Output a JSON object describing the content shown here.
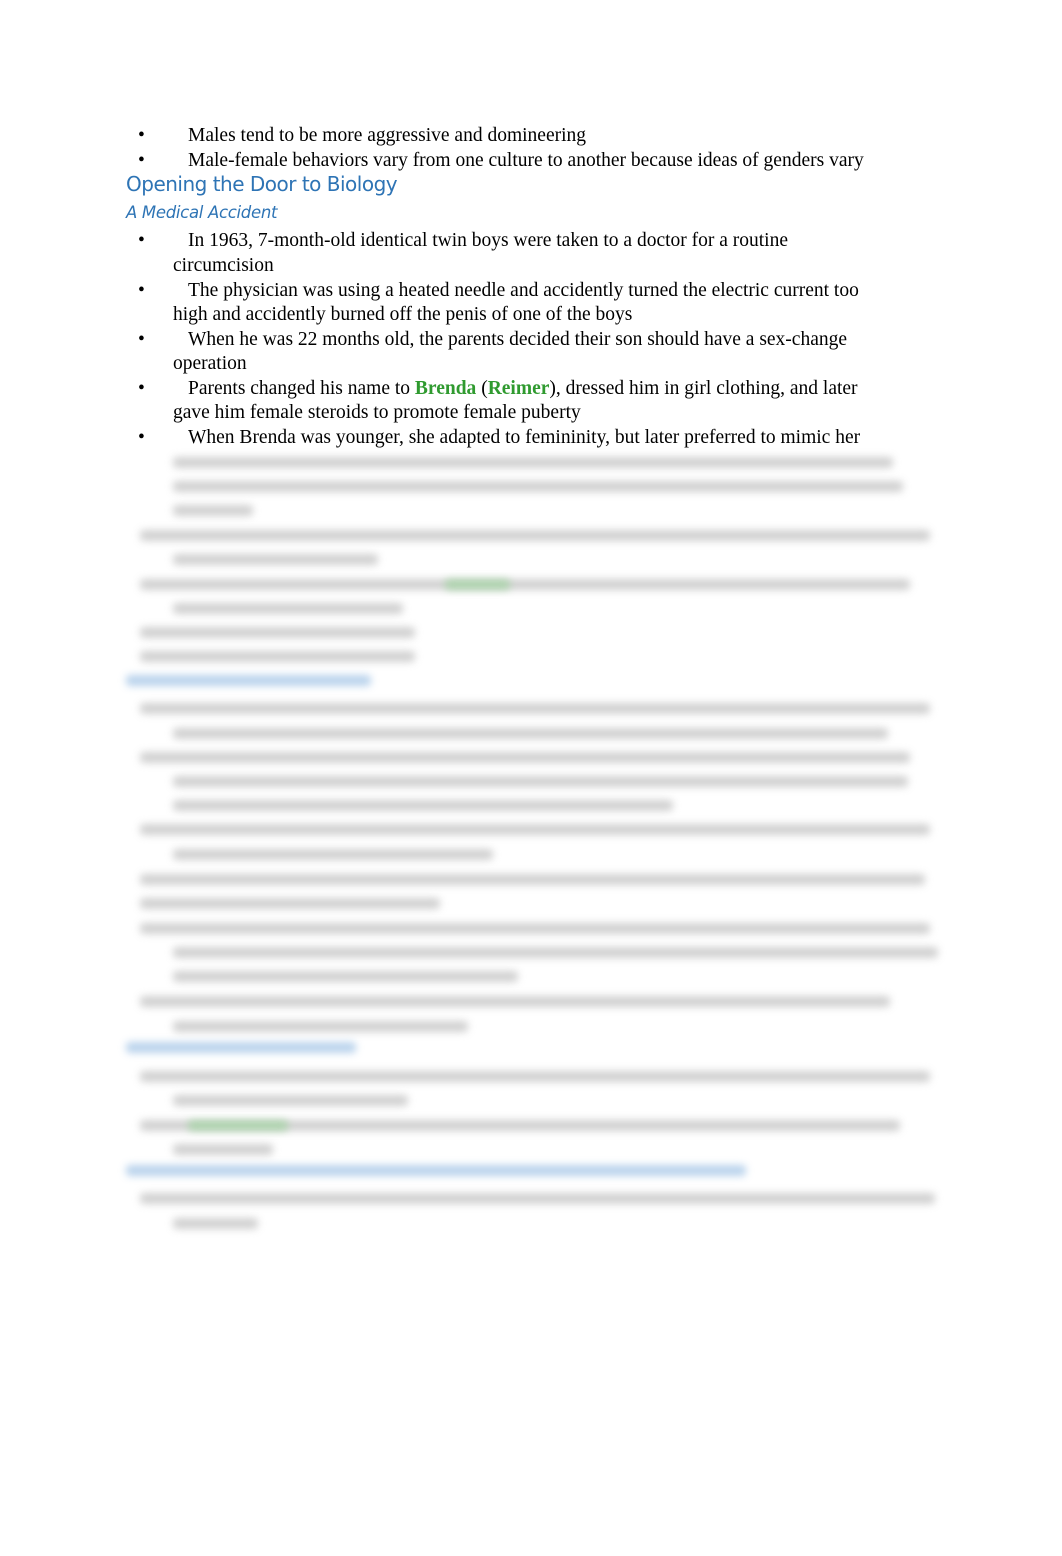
{
  "top_bullets": [
    "Males tend to be more aggressive and domineering",
    "Male-female behaviors vary from one culture to another because ideas of genders vary"
  ],
  "heading": "Opening the Door to Biology",
  "subheading": "A Medical Accident",
  "bullet_char": "•",
  "colors": {
    "heading": "#2e74b5",
    "highlight": "#2f9a2f"
  },
  "bullets": {
    "b1_l1": "In 1963, 7-month-old identical twin boys were taken to a doctor for a routine",
    "b1_l2": "circumcision",
    "b2_l1": "The physician was using a heated needle and accidently turned the electric current too",
    "b2_l2": "high and accidently burned off the penis of one of the boys",
    "b3_l1": "When he was 22 months old, the parents decided their son should have a sex-change",
    "b3_l2": "operation",
    "b4_pre": "Parents changed his name to ",
    "b4_name1": "Brenda",
    "b4_paren_open": " (",
    "b4_name2": "Reimer",
    "b4_post": "), dressed him in girl clothing, and later",
    "b4_l2": "gave him female steroids to promote female puberty",
    "b5_l1": "When Brenda was younger, she adapted to femininity, but later preferred to mimic her"
  }
}
